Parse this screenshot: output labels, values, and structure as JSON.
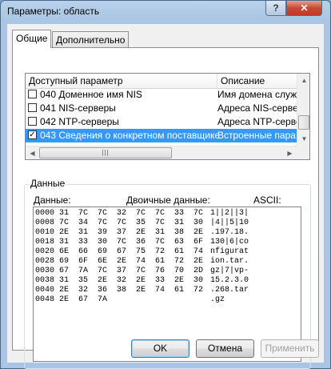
{
  "window": {
    "title": "Параметры: область"
  },
  "tabs": [
    {
      "label": "Общие"
    },
    {
      "label": "Дополнительно"
    }
  ],
  "options_list": {
    "columns": {
      "param": "Доступный параметр",
      "desc": "Описание"
    },
    "rows": [
      {
        "checked": false,
        "name": "040 Доменное имя NIS",
        "desc": "Имя домена служ"
      },
      {
        "checked": false,
        "name": "041 NIS-серверы",
        "desc": "Адреса NIS-серве"
      },
      {
        "checked": false,
        "name": "042 NTP-серверы",
        "desc": "Адреса NTP-серве"
      },
      {
        "checked": true,
        "name": "043 Сведения о конкретном поставщике",
        "desc": "Встроенные пара"
      }
    ]
  },
  "data_group": {
    "label": "Данные",
    "data_label": "Данные:",
    "binary_label": "Двоичные данные:",
    "ascii_label": "ASCII:",
    "rows": [
      {
        "offset": "0000",
        "bytes": "31  7C  7C  32  7C  7C  33  7C",
        "ascii": "1||2||3|"
      },
      {
        "offset": "0008",
        "bytes": "7C  34  7C  7C  35  7C  31  30",
        "ascii": "|4||5|10"
      },
      {
        "offset": "0010",
        "bytes": "2E  31  39  37  2E  31  38  2E",
        "ascii": ".197.18."
      },
      {
        "offset": "0018",
        "bytes": "31  33  30  7C  36  7C  63  6F",
        "ascii": "130|6|co"
      },
      {
        "offset": "0020",
        "bytes": "6E  66  69  67  75  72  61  74",
        "ascii": "nfigurat"
      },
      {
        "offset": "0028",
        "bytes": "69  6F  6E  2E  74  61  72  2E",
        "ascii": "ion.tar."
      },
      {
        "offset": "0030",
        "bytes": "67  7A  7C  37  7C  76  70  2D",
        "ascii": "gz|7|vp-"
      },
      {
        "offset": "0038",
        "bytes": "31  35  2E  32  2E  33  2E  30",
        "ascii": "15.2.3.0"
      },
      {
        "offset": "0040",
        "bytes": "2E  32  36  38  2E  74  61  72",
        "ascii": ".268.tar"
      },
      {
        "offset": "0048",
        "bytes": "2E  67  7A",
        "ascii": ".gz"
      }
    ]
  },
  "buttons": {
    "ok": "OK",
    "cancel": "Отмена",
    "apply": "Применить"
  },
  "icons": {
    "help": "help-icon",
    "close": "close-icon"
  }
}
